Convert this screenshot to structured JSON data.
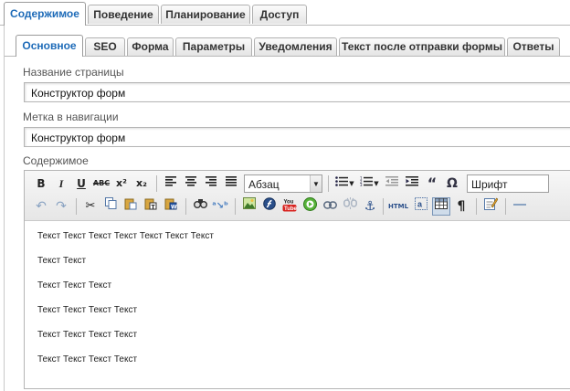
{
  "top_tabs": [
    "Содержимое",
    "Поведение",
    "Планирование",
    "Доступ"
  ],
  "sub_tabs": [
    "Основное",
    "SEO",
    "Форма",
    "Параметры",
    "Уведомления",
    "Текст после отправки формы",
    "Ответы"
  ],
  "fields": {
    "page_name_label": "Название страницы",
    "page_name_value": "Конструктор форм",
    "nav_label": "Метка в навигации",
    "nav_value": "Конструктор форм",
    "content_label": "Содержимое"
  },
  "toolbar": {
    "bold": "B",
    "italic": "I",
    "underline": "U",
    "strike": "ABC",
    "superscript": "x²",
    "subscript": "x₂",
    "format_value": "Абзац",
    "font_value": "Шрифт",
    "youtube": "You Tube",
    "html": "HTML",
    "pilcrow": "¶",
    "quote": "“",
    "omega": "Ω"
  },
  "content": [
    "Текст Текст Текст Текст Текст Текст Текст",
    "Текст Текст",
    "Текст Текст Текст",
    "Текст Текст Текст Текст",
    "Текст Текст Текст Текст",
    " Текст Текст Текст Текст"
  ],
  "colors": {
    "active_tab_text": "#1e6bb8",
    "tab_border": "#b0b0b0",
    "toolbar_bg": "#ececec"
  }
}
